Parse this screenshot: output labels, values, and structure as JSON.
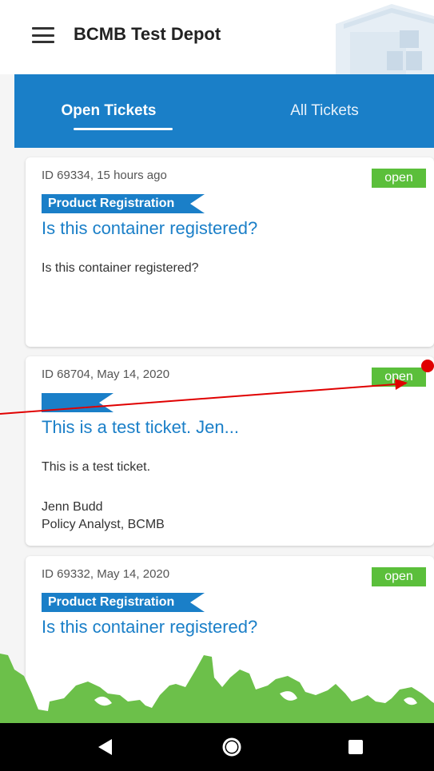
{
  "app_bar": {
    "title": "BCMB Test Depot",
    "menu_icon": "hamburger-menu-icon",
    "logo_icon": "depot-building-icon"
  },
  "tabs": [
    {
      "label": "Open Tickets",
      "selected": true
    },
    {
      "label": "All Tickets",
      "selected": false
    }
  ],
  "tickets": [
    {
      "meta": "ID 69334, 15 hours ago",
      "status": "open",
      "category": "Product Registration",
      "title": "Is this container registered?",
      "body": "Is this container registered?",
      "signature_name": "",
      "signature_role": ""
    },
    {
      "meta": "ID 68704, May 14, 2020",
      "status": "open",
      "category": "",
      "title": "This is a test ticket. Jen...",
      "body": "This is a test ticket.",
      "signature_name": "Jenn Budd",
      "signature_role": "Policy Analyst, BCMB"
    },
    {
      "meta": "ID 69332, May 14, 2020",
      "status": "open",
      "category": "Product Registration",
      "title": "Is this container registered?",
      "body": "",
      "signature_name": "",
      "signature_role": ""
    }
  ],
  "nav_bar": {
    "back_icon": "back-triangle-icon",
    "home_icon": "home-circle-icon",
    "recents_icon": "recents-square-icon"
  },
  "colors": {
    "primary_blue": "#1a7fc8",
    "status_green": "#5bbf3b",
    "footer_green": "#6cc04a",
    "annotation_red": "#e00000"
  }
}
